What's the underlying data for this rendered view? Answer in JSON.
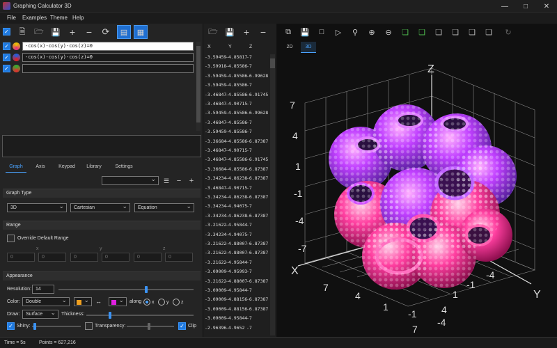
{
  "window": {
    "title": "Graphing Calculator 3D"
  },
  "menu": [
    "File",
    "Examples",
    "Theme",
    "Help"
  ],
  "equations": [
    {
      "enabled": true,
      "text": "-cos(x)-cos(y)-cos(z)=0",
      "color": "#e6c400"
    },
    {
      "enabled": true,
      "text": "-cos(x)-cos(y)-cos(z)=0",
      "color": "#2060e0"
    },
    {
      "enabled": true,
      "text": "",
      "color": "#30b030"
    }
  ],
  "tabs": [
    "Graph",
    "Axis",
    "Keypad",
    "Library",
    "Settings"
  ],
  "graph_type": {
    "header": "Graph Type",
    "dimension": "3D",
    "coords": "Cartesian",
    "form": "Equation"
  },
  "range": {
    "header": "Range",
    "override_label": "Override Default Range",
    "x_label": "x",
    "y_label": "y",
    "z_label": "z",
    "min_val": "0",
    "max_val": "0"
  },
  "appearance": {
    "header": "Appearance",
    "resolution_label": "Resolution:",
    "resolution_value": "14",
    "color_label": "Color:",
    "color_mode": "Double",
    "color1": "#f0a020",
    "color2": "#e020e0",
    "along_label": "along",
    "axis_x": "x",
    "axis_y": "y",
    "axis_z": "z",
    "draw_label": "Draw:",
    "draw_mode": "Surface",
    "thickness_label": "Thickness:",
    "shiny_label": "Shiny:",
    "transparency_label": "Transparency:",
    "clip_label": "Clip"
  },
  "table": {
    "headers": [
      "X",
      "Y",
      "Z"
    ],
    "rows": [
      [
        "-3.59459",
        "-4.85817",
        "-7"
      ],
      [
        "-3.59918",
        "-4.85586",
        "-7"
      ],
      [
        "-3.59459",
        "-4.85586",
        "-6.99628"
      ],
      [
        "-3.59459",
        "-4.85586",
        "-7"
      ],
      [
        "-3.46847",
        "-4.85586",
        "-6.91745"
      ],
      [
        "-3.46847",
        "-4.90715",
        "-7"
      ],
      [
        "-3.59459",
        "-4.85586",
        "-6.99628"
      ],
      [
        "-3.46847",
        "-4.85586",
        "-7"
      ],
      [
        "-3.59459",
        "-4.85586",
        "-7"
      ],
      [
        "-3.36684",
        "-4.85586",
        "-6.87387"
      ],
      [
        "-3.46847",
        "-4.90715",
        "-7"
      ],
      [
        "-3.46847",
        "-4.85586",
        "-6.91745"
      ],
      [
        "-3.36684",
        "-4.85586",
        "-6.87387"
      ],
      [
        "-3.34234",
        "-4.86238",
        "-6.87387"
      ],
      [
        "-3.46847",
        "-4.90715",
        "-7"
      ],
      [
        "-3.34234",
        "-4.86238",
        "-6.87387"
      ],
      [
        "-3.34234",
        "-4.94075",
        "-7"
      ],
      [
        "-3.34234",
        "-4.86238",
        "-6.87387"
      ],
      [
        "-3.21622",
        "-4.95844",
        "-7"
      ],
      [
        "-3.34234",
        "-4.94075",
        "-7"
      ],
      [
        "-3.21622",
        "-4.88007",
        "-6.87387"
      ],
      [
        "-3.21622",
        "-4.88007",
        "-6.87387"
      ],
      [
        "-3.21622",
        "-4.95844",
        "-7"
      ],
      [
        "-3.09009",
        "-4.95993",
        "-7"
      ],
      [
        "-3.21622",
        "-4.88007",
        "-6.87387"
      ],
      [
        "-3.09009",
        "-4.95844",
        "-7"
      ],
      [
        "-3.09009",
        "-4.88156",
        "-6.87387"
      ],
      [
        "-3.09009",
        "-4.88156",
        "-6.87387"
      ],
      [
        "-3.09009",
        "-4.95844",
        "-7"
      ],
      [
        "-2.96396",
        "-4.9652",
        "-7"
      ]
    ]
  },
  "view_tabs": [
    "2D",
    "3D"
  ],
  "axis_labels": {
    "z": "Z",
    "x": "X",
    "y": "Y"
  },
  "z_ticks": [
    "7",
    "4",
    "1",
    "-1",
    "-4",
    "-7"
  ],
  "x_ticks": [
    "7",
    "4",
    "1",
    "-1",
    "-4"
  ],
  "y_ticks": [
    "-4",
    "-1",
    "1",
    "4",
    "7"
  ],
  "status": {
    "time": "Time = 5s",
    "points": "Points = 627,216"
  },
  "colors": {
    "accent": "#1f6fd1",
    "surface_top": "#8a5cff",
    "surface_bottom": "#ff3fa0"
  }
}
